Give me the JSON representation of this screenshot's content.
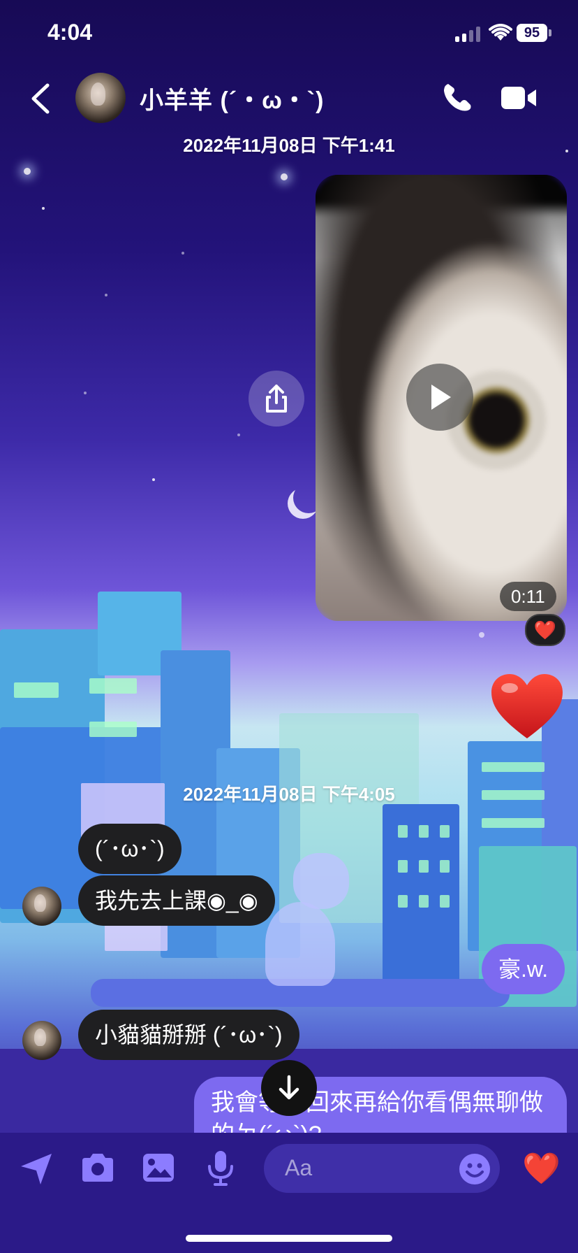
{
  "status_bar": {
    "time": "4:04",
    "battery": "95",
    "signal_bars_active": 2,
    "signal_bars_total": 4
  },
  "header": {
    "contact_name": "小羊羊 (´・ω・`)",
    "icons": [
      "back-chevron-icon",
      "phone-icon",
      "video-camera-icon"
    ]
  },
  "conversation": {
    "timestamp_1": "2022年11月08日 下午1:41",
    "video": {
      "duration": "0:11",
      "reaction": "❤️"
    },
    "big_heart": "❤️",
    "timestamp_2": "2022年11月08日 下午4:05",
    "messages": [
      {
        "direction": "in",
        "text": "(´･ω･`)"
      },
      {
        "direction": "in",
        "text": "我先去上課◉_◉"
      },
      {
        "direction": "out",
        "text": "豪.w."
      },
      {
        "direction": "in",
        "text": "小貓貓掰掰 (´･ω･`)"
      },
      {
        "direction": "out",
        "text": "我會等你回來再給你看偶無聊做的ㄉ(´ω`)?"
      }
    ]
  },
  "composer": {
    "placeholder": "Aa",
    "icons": [
      "location-arrow-icon",
      "camera-icon",
      "photo-icon",
      "microphone-icon",
      "emoji-icon",
      "heart-icon"
    ],
    "like_emoji": "❤️"
  },
  "colors": {
    "accent": "#7d6af0",
    "incoming_bubble": "#1f1f21",
    "composer_bg": "#2b1a88"
  }
}
